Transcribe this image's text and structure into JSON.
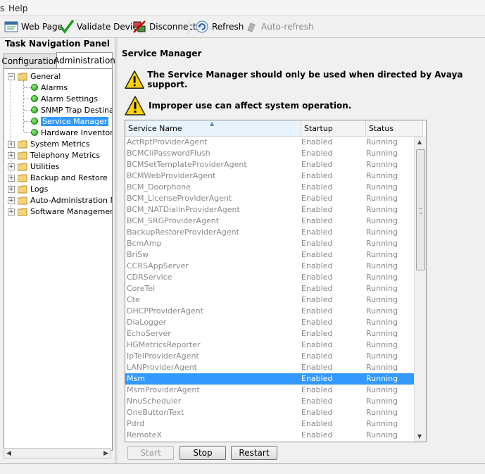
{
  "menu": {
    "items": [
      "s",
      "Help"
    ]
  },
  "toolbar": {
    "web_page": "Web Page",
    "validate_device": "Validate Device",
    "disconnect": "Disconnect",
    "refresh": "Refresh",
    "auto_refresh": "Auto-refresh"
  },
  "nav": {
    "title": "Task Navigation Panel",
    "tabs": [
      "Configuration",
      "Administration"
    ],
    "tree": {
      "general": "General",
      "children": [
        "Alarms",
        "Alarm Settings",
        "SNMP Trap Destinati",
        "Service Manager",
        "Hardware Inventory"
      ],
      "folders": [
        "System Metrics",
        "Telephony Metrics",
        "Utilities",
        "Backup and Restore",
        "Logs",
        "Auto-Administration Ma",
        "Software Management"
      ]
    }
  },
  "content": {
    "heading": "Service Manager",
    "warning1": "The Service Manager should only be used when directed by Avaya support.",
    "warning2": "Improper use can affect system operation.",
    "columns": [
      "Service Name",
      "Startup",
      "Status"
    ],
    "selected_index": 21,
    "rows": [
      [
        "ActRptProviderAgent",
        "Enabled",
        "Running"
      ],
      [
        "BCMCliPasswordFlush",
        "Enabled",
        "Running"
      ],
      [
        "BCMSetTemplateProviderAgent",
        "Enabled",
        "Running"
      ],
      [
        "BCMWebProviderAgent",
        "Enabled",
        "Running"
      ],
      [
        "BCM_Doorphone",
        "Enabled",
        "Running"
      ],
      [
        "BCM_LicenseProviderAgent",
        "Enabled",
        "Running"
      ],
      [
        "BCM_NATDialinProviderAgent",
        "Enabled",
        "Running"
      ],
      [
        "BCM_SRGProviderAgent",
        "Enabled",
        "Running"
      ],
      [
        "BackupRestoreProviderAgent",
        "Enabled",
        "Running"
      ],
      [
        "BcmAmp",
        "Enabled",
        "Running"
      ],
      [
        "BriSw",
        "Enabled",
        "Running"
      ],
      [
        "CCRSAppServer",
        "Enabled",
        "Running"
      ],
      [
        "CDRService",
        "Enabled",
        "Running"
      ],
      [
        "CoreTel",
        "Enabled",
        "Running"
      ],
      [
        "Cte",
        "Enabled",
        "Running"
      ],
      [
        "DHCPProviderAgent",
        "Enabled",
        "Running"
      ],
      [
        "DiaLogger",
        "Enabled",
        "Running"
      ],
      [
        "EchoServer",
        "Enabled",
        "Running"
      ],
      [
        "HGMetricsReporter",
        "Enabled",
        "Running"
      ],
      [
        "IpTelProviderAgent",
        "Enabled",
        "Running"
      ],
      [
        "LANProviderAgent",
        "Enabled",
        "Running"
      ],
      [
        "Msm",
        "Enabled",
        "Running"
      ],
      [
        "MsmProviderAgent",
        "Enabled",
        "Running"
      ],
      [
        "NnuScheduler",
        "Enabled",
        "Running"
      ],
      [
        "OneButtonText",
        "Enabled",
        "Running"
      ],
      [
        "Pdrd",
        "Enabled",
        "Running"
      ],
      [
        "RemoteX",
        "Enabled",
        "Running"
      ]
    ],
    "buttons": {
      "start": "Start",
      "stop": "Stop",
      "restart": "Restart"
    }
  }
}
